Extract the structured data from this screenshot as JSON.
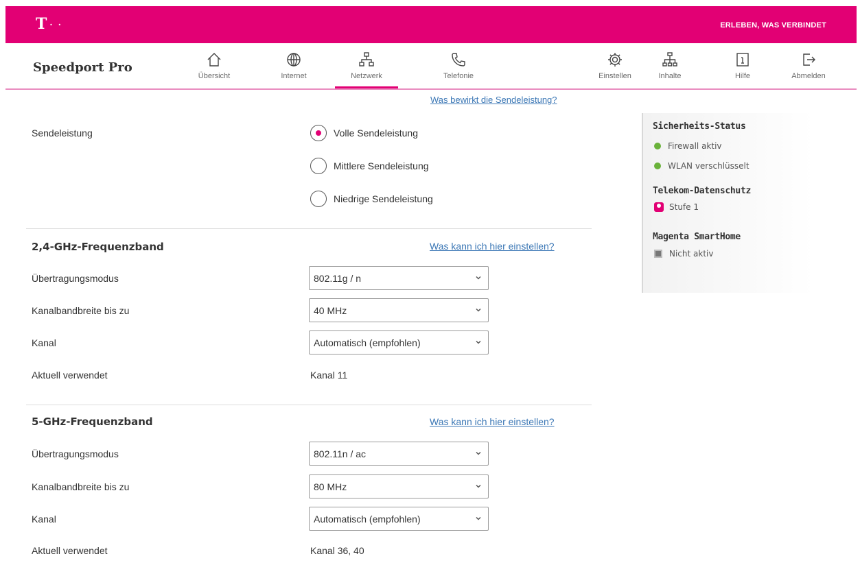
{
  "header": {
    "logo_text": "T",
    "logo_dots": "· ·",
    "slogan": "ERLEBEN, WAS VERBINDET"
  },
  "nav": {
    "brand": "Speedport Pro",
    "items": [
      {
        "label": "Übersicht",
        "icon": "home-icon"
      },
      {
        "label": "Internet",
        "icon": "globe-icon"
      },
      {
        "label": "Netzwerk",
        "icon": "network-icon",
        "active": true
      },
      {
        "label": "Telefonie",
        "icon": "phone-icon"
      }
    ],
    "right_items": [
      {
        "label": "Einstellen",
        "icon": "gear-icon"
      },
      {
        "label": "Inhalte",
        "icon": "tree-icon"
      },
      {
        "label": "Hilfe",
        "icon": "info-icon"
      },
      {
        "label": "Abmelden",
        "icon": "logout-icon"
      }
    ]
  },
  "power": {
    "help_link": "Was bewirkt die Sendeleistung?",
    "label": "Sendeleistung",
    "options": [
      "Volle Sendeleistung",
      "Mittlere Sendeleistung",
      "Niedrige Sendeleistung"
    ],
    "selected_index": 0
  },
  "band24": {
    "title": "2,4-GHz-Frequenzband",
    "help_link": "Was kann ich hier einstellen?",
    "mode_label": "Übertragungsmodus",
    "mode_value": "802.11g / n",
    "bandwidth_label": "Kanalbandbreite bis zu",
    "bandwidth_value": "40 MHz",
    "channel_label": "Kanal",
    "channel_value": "Automatisch (empfohlen)",
    "current_label": "Aktuell verwendet",
    "current_value": "Kanal 11"
  },
  "band5": {
    "title": "5-GHz-Frequenzband",
    "help_link": "Was kann ich hier einstellen?",
    "mode_label": "Übertragungsmodus",
    "mode_value": "802.11n / ac",
    "bandwidth_label": "Kanalbandbreite bis zu",
    "bandwidth_value": "80 MHz",
    "channel_label": "Kanal",
    "channel_value": "Automatisch (empfohlen)",
    "current_label": "Aktuell verwendet",
    "current_value": "Kanal 36, 40"
  },
  "sidebar": {
    "security_title": "Sicherheits-Status",
    "firewall": "Firewall aktiv",
    "wlan": "WLAN verschlüsselt",
    "privacy_title": "Telekom-Datenschutz",
    "privacy_level": "Stufe 1",
    "smarthome_title": "Magenta SmartHome",
    "smarthome_status": "Nicht aktiv"
  },
  "colors": {
    "brand": "#e20074",
    "link": "#3b77b5",
    "status_green": "#6ab23a"
  }
}
